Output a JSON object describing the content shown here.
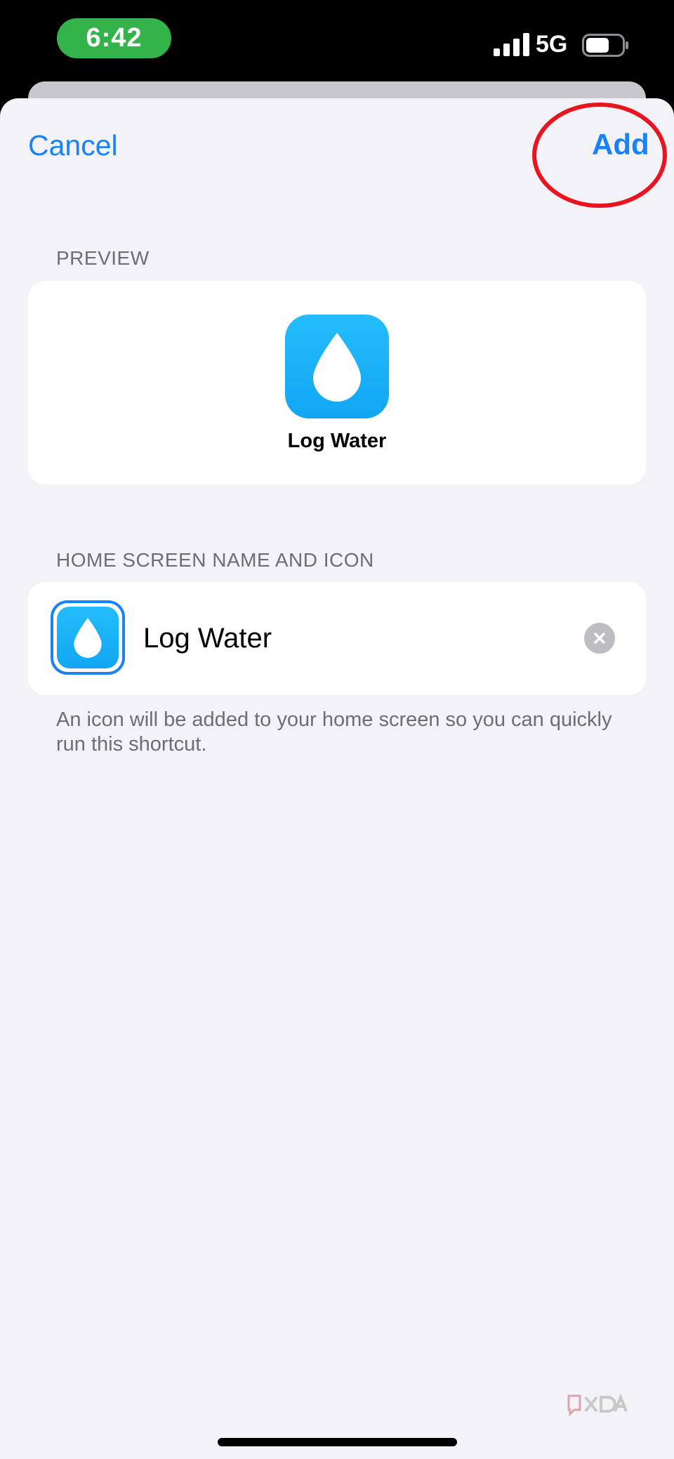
{
  "status_bar": {
    "time": "6:42",
    "network": "5G",
    "icons": [
      "signal-bars-icon",
      "battery-icon"
    ]
  },
  "nav": {
    "cancel_label": "Cancel",
    "add_label": "Add",
    "accent_color": "#1a82f7",
    "annotation_color": "#e8141e"
  },
  "preview": {
    "header": "PREVIEW",
    "icon": "water-drop-icon",
    "icon_color": "#18b0f7",
    "label": "Log Water"
  },
  "home_screen": {
    "header": "HOME SCREEN NAME AND ICON",
    "icon": "water-drop-icon",
    "name_value": "Log Water",
    "clear_icon": "clear-x-icon",
    "footer_note": "An icon will be added to your home screen so you can quickly run this shortcut."
  },
  "watermark": {
    "icon": "xda-logo"
  }
}
